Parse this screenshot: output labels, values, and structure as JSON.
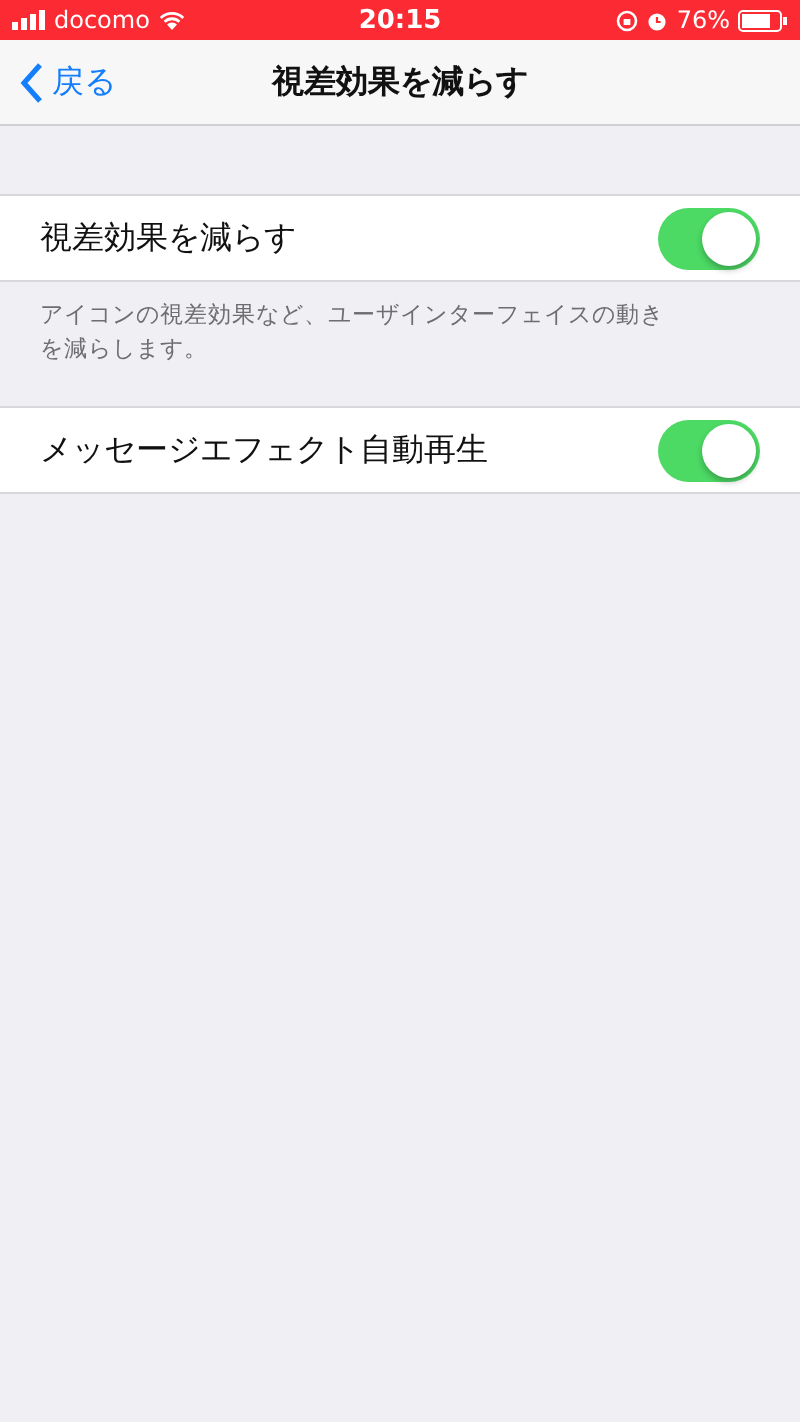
{
  "status_bar": {
    "carrier": "docomo",
    "time": "20:15",
    "battery": "76%"
  },
  "nav": {
    "back": "戻る",
    "title": "視差効果を減らす"
  },
  "sections": [
    {
      "rows": [
        {
          "label": "視差効果を減らす",
          "on": true
        }
      ],
      "footer": "アイコンの視差効果など、ユーザインターフェイスの動きを減らします。"
    },
    {
      "rows": [
        {
          "label": "メッセージエフェクト自動再生",
          "on": true
        }
      ]
    }
  ]
}
